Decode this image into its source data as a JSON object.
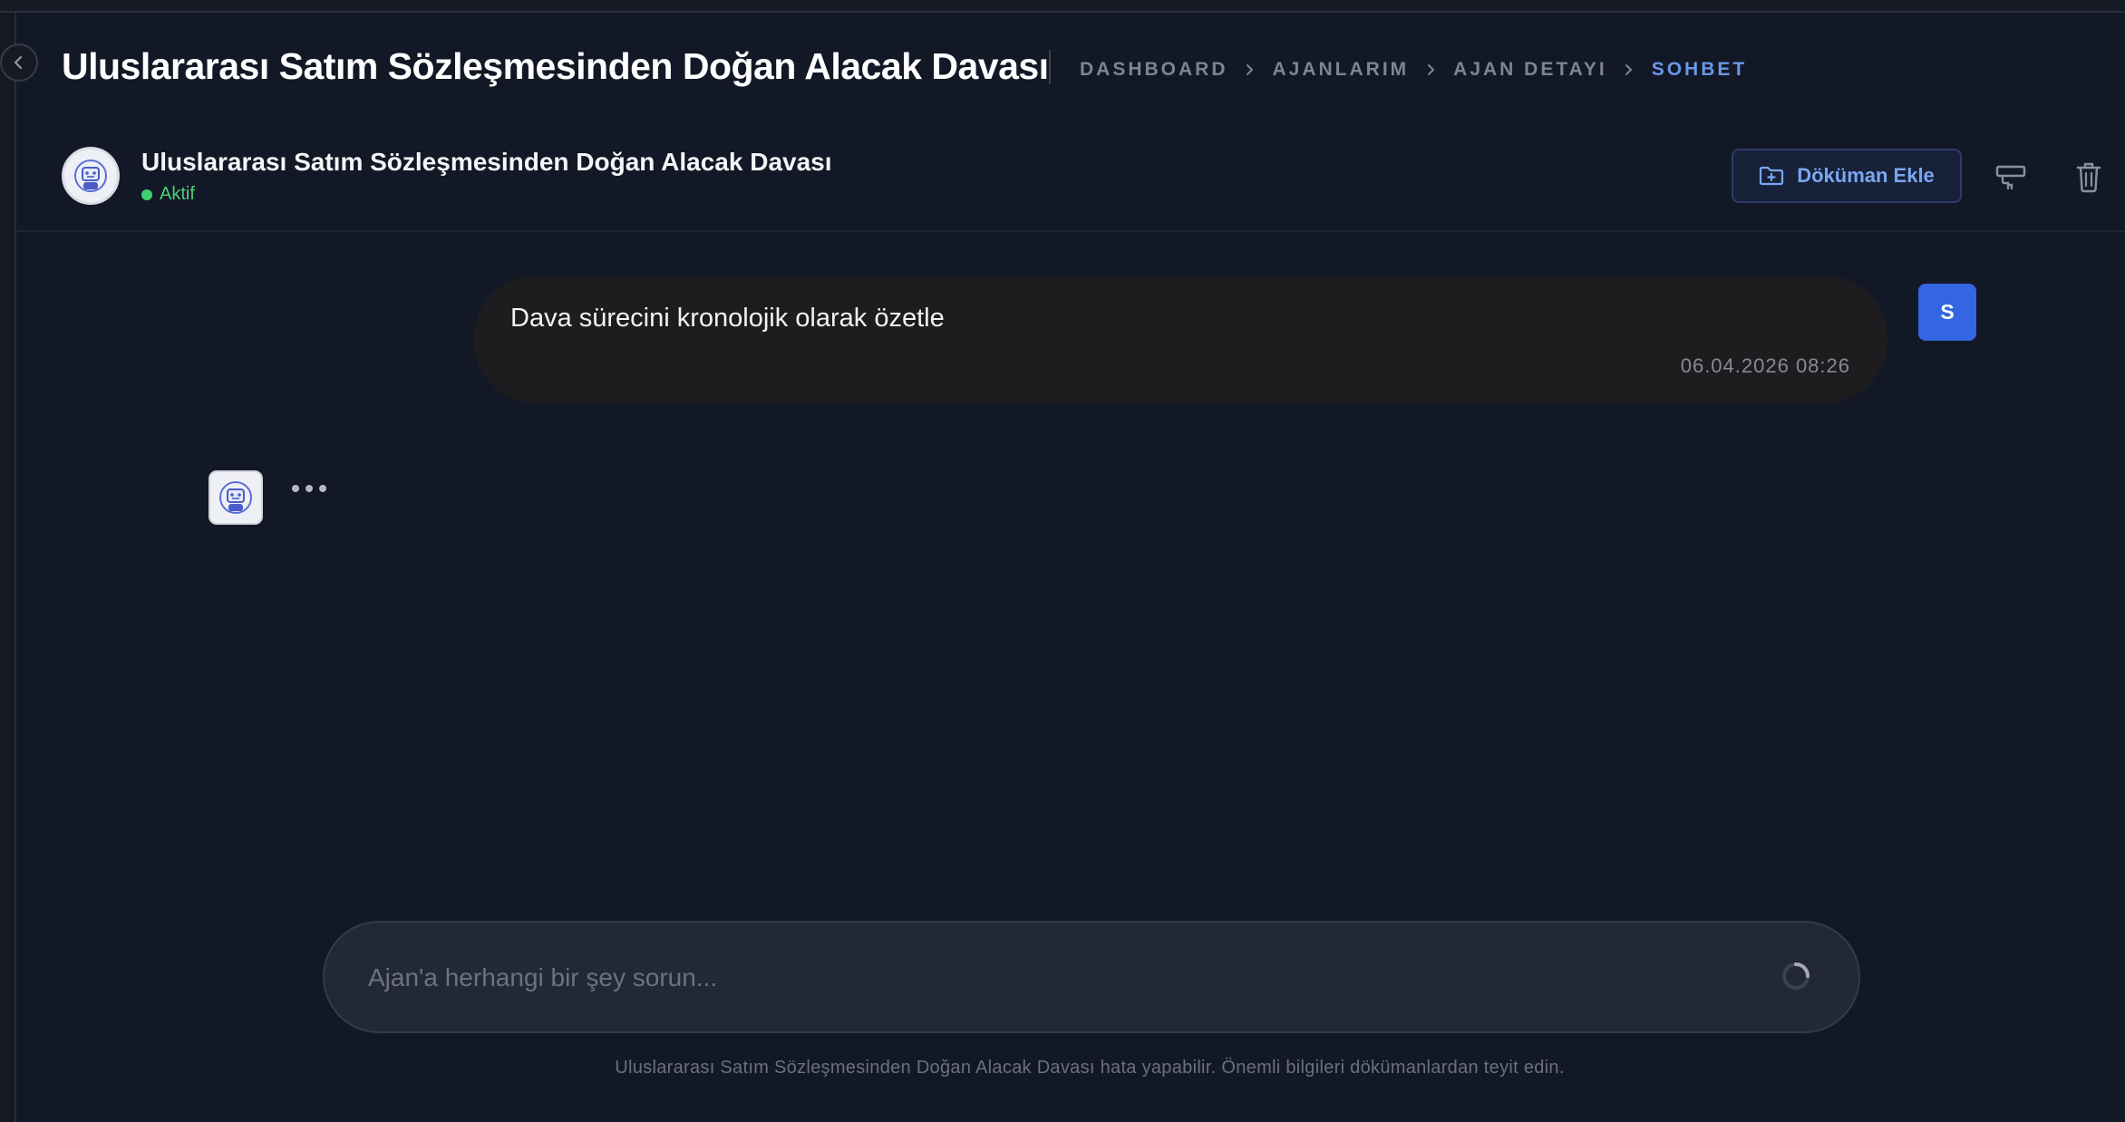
{
  "page": {
    "title": "Uluslararası Satım Sözleşmesinden Doğan Alacak Davası"
  },
  "breadcrumb": {
    "items": [
      "DASHBOARD",
      "AJANLARIM",
      "AJAN DETAYI",
      "SOHBET"
    ],
    "active_index": 3
  },
  "agent": {
    "name": "Uluslararası Satım Sözleşmesinden Doğan Alacak Davası",
    "status": "Aktif",
    "avatar_icon": "robot-icon"
  },
  "toolbar": {
    "add_document_label": "Döküman Ekle",
    "add_document_icon": "folder-plus-icon",
    "clear_icon": "eraser-icon",
    "delete_icon": "trash-icon"
  },
  "chat": {
    "messages": [
      {
        "role": "user",
        "text": "Dava sürecini kronolojik olarak özetle",
        "time": "06.04.2026 08:26",
        "avatar_initial": "S"
      }
    ],
    "bot_typing": true
  },
  "composer": {
    "placeholder": "Ajan'a herhangi bir şey sorun...",
    "value": ""
  },
  "footer": {
    "disclaimer": "Uluslararası Satım Sözleşmesinden Doğan Alacak Davası hata yapabilir. Önemli bilgileri dökümanlardan teyit edin."
  },
  "colors": {
    "background": "#131826",
    "accent": "#3366e0",
    "active_crumb": "#6a97e8",
    "status_green": "#3fcf6e"
  }
}
